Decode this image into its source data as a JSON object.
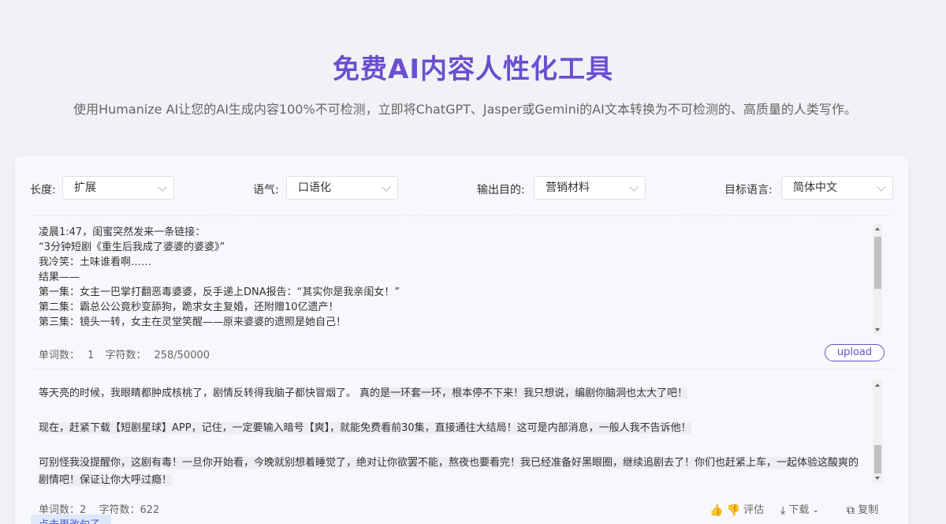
{
  "hero": {
    "title": "免费AI内容人性化工具",
    "subtitle": "使用Humanize AI让您的AI生成内容100%不可检测，立即将ChatGPT、Jasper或Gemini的AI文本转换为不可检测的、高质量的人类写作。"
  },
  "options": {
    "length": {
      "label": "长度:",
      "value": "扩展"
    },
    "tone": {
      "label": "语气:",
      "value": "口语化"
    },
    "purpose": {
      "label": "输出目的:",
      "value": "营销材料"
    },
    "language": {
      "label": "目标语言:",
      "value": "简体中文"
    }
  },
  "input": {
    "text": "凌晨1:47，闺蜜突然发来一条链接：\n“3分钟短剧《重生后我成了婆婆的婆婆》”\n我冷笑：土味谁看啊……\n结果——\n第一集：女主一巴掌打翻恶毒婆婆，反手递上DNA报告：“其实你是我亲闺女！”\n第二集：霸总公公竟秒变舔狗，跪求女主复婚，还附赠10亿遗产！\n第三集：镜头一转，女主在灵堂笑醒——原来婆婆的遗照是她自己！",
    "word_count_label": "单词数：",
    "word_count": "1",
    "char_count_label": "字符数：",
    "char_count": "258/50000",
    "upload_label": "upload"
  },
  "output": {
    "paragraphs": [
      {
        "plain": "等天亮的时候，我眼睛都肿成核桃了，剧情反转得我脑子都快冒烟了。",
        "highlight": "真的是一环套一环，根本停不下来！我只想说，编剧你脑洞也太大了吧！"
      },
      {
        "plain": "",
        "highlight": "现在，赶紧下载【短剧星球】APP，记住，一定要输入暗号【爽】，就能免费看前30集，直接通往大结局！这可是内部消息，一般人我不告诉他！"
      },
      {
        "plain": "",
        "highlight": "可别怪我没提醒你，这剧有毒！一旦你开始看，今晚就别想着睡觉了，绝对让你欲罢不能，熬夜也要看完！我已经准备好黑眼圈，继续追剧去了！你们也赶紧上车，一起体验这酸爽的剧情吧！保证让你大呼过瘾！"
      }
    ],
    "word_count_label": "单词数：",
    "word_count": "2",
    "char_count_label": "字符数：",
    "char_count": "622",
    "rate_label": "评估",
    "download_label": "下载",
    "copy_label": "复制"
  },
  "tooltip": "点击更改句子"
}
